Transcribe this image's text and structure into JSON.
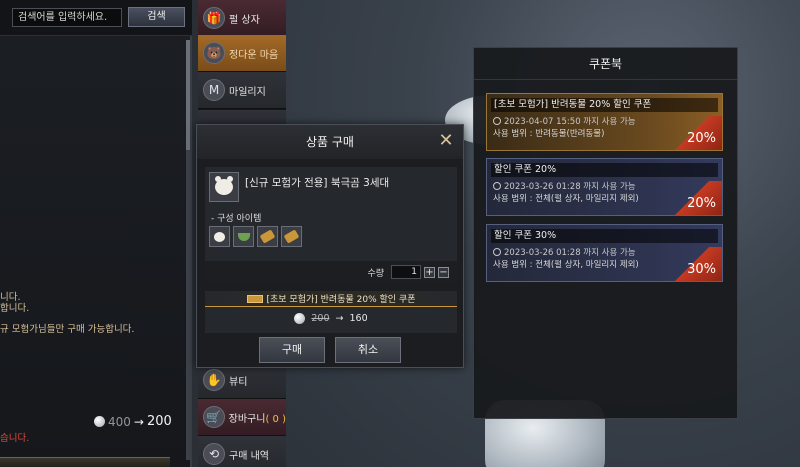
{
  "search": {
    "placeholder": "검색어를 입력하세요.",
    "button_label": "검색"
  },
  "left_panel": {
    "notices": [
      {
        "text": "니다."
      },
      {
        "text": "합니다."
      },
      {
        "text": "규 모험가님들만 구매 가능합니다."
      },
      {
        "text": "습니다."
      }
    ],
    "price": {
      "old": "400",
      "arrow": "→",
      "new": "200"
    }
  },
  "categories": [
    {
      "label": "펄 상자",
      "icon": "🎁"
    },
    {
      "label": "정다운 마음",
      "icon": "🐻"
    },
    {
      "label": "마일리지",
      "icon": "M"
    },
    {
      "label": "뷰티",
      "icon": "✋"
    },
    {
      "label": "장바구니",
      "count": "( 0 )",
      "icon": "🛒"
    },
    {
      "label": "구매 내역",
      "icon": "⟲"
    }
  ],
  "coupon_book": {
    "title": "쿠폰북",
    "coupons": [
      {
        "name": "[초보 모험가] 반려동물 20% 할인 쿠폰",
        "expiry": "2023-04-07 15:50 까지 사용 가능",
        "scope": "사용 범위 : 반려동물(반려동물)",
        "percent": "20%",
        "style": "gold"
      },
      {
        "name": "할인 쿠폰 20%",
        "expiry": "2023-03-26 01:28 까지 사용 가능",
        "scope": "사용 범위 : 전체(펄 상자, 마일리지 제외)",
        "percent": "20%",
        "style": "blue"
      },
      {
        "name": "할인 쿠폰 30%",
        "expiry": "2023-03-26 01:28 까지 사용 가능",
        "scope": "사용 범위 : 전체(펄 상자, 마일리지 제외)",
        "percent": "30%",
        "style": "blue"
      }
    ]
  },
  "dialog": {
    "title": "상품 구매",
    "product_name": "[신규 모험가 전용] 북극곰 3세대",
    "components_label": "- 구성 아이템",
    "quantity_label": "수량",
    "quantity_value": "1",
    "applied_coupon": "[초보 모험가] 반려동물 20% 할인 쿠폰",
    "original_price": "200",
    "arrow": "→",
    "discounted_price": "160",
    "buy_label": "구매",
    "cancel_label": "취소"
  }
}
